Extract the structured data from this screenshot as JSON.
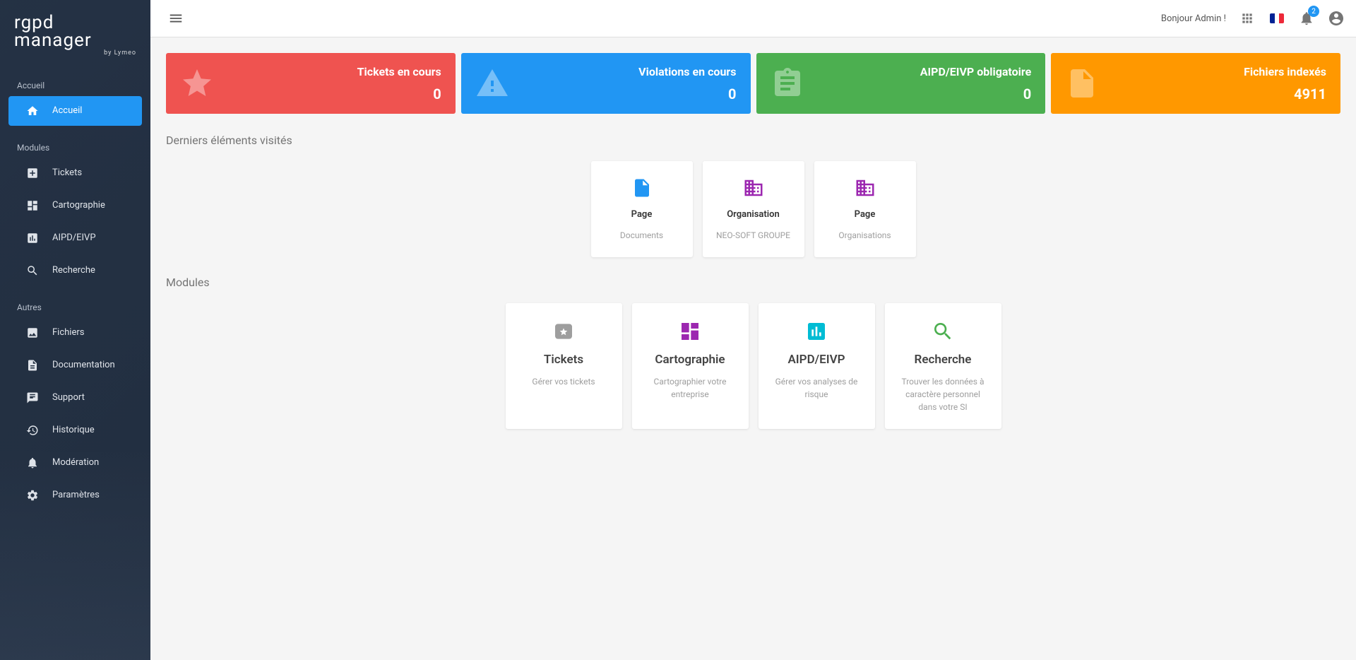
{
  "app": {
    "name": "rgpd manager",
    "logo_line1": "rgpd",
    "logo_line2": "manager",
    "logo_sub": "by Lymeo"
  },
  "header": {
    "greeting": "Bonjour Admin !",
    "notification_count": "2"
  },
  "sidebar": {
    "section_accueil": "Accueil",
    "section_modules": "Modules",
    "section_autres": "Autres",
    "items": {
      "accueil": "Accueil",
      "tickets": "Tickets",
      "cartographie": "Cartographie",
      "aipd": "AIPD/EIVP",
      "recherche": "Recherche",
      "fichiers": "Fichiers",
      "documentation": "Documentation",
      "support": "Support",
      "historique": "Historique",
      "moderation": "Modération",
      "parametres": "Paramètres"
    }
  },
  "stats": {
    "tickets": {
      "label": "Tickets en cours",
      "value": "0"
    },
    "violations": {
      "label": "Violations en cours",
      "value": "0"
    },
    "aipd": {
      "label": "AIPD/EIVP obligatoire",
      "value": "0"
    },
    "fichiers": {
      "label": "Fichiers indexés",
      "value": "4911"
    }
  },
  "sections": {
    "recent": "Derniers éléments visités",
    "modules": "Modules"
  },
  "recent": [
    {
      "type": "Page",
      "sub": "Documents"
    },
    {
      "type": "Organisation",
      "sub": "NEO-SOFT GROUPE"
    },
    {
      "type": "Page",
      "sub": "Organisations"
    }
  ],
  "modules": [
    {
      "title": "Tickets",
      "sub": "Gérer vos tickets"
    },
    {
      "title": "Cartographie",
      "sub": "Cartographier votre entreprise"
    },
    {
      "title": "AIPD/EIVP",
      "sub": "Gérer vos analyses de risque"
    },
    {
      "title": "Recherche",
      "sub": "Trouver les données à caractère personnel dans votre SI"
    }
  ]
}
